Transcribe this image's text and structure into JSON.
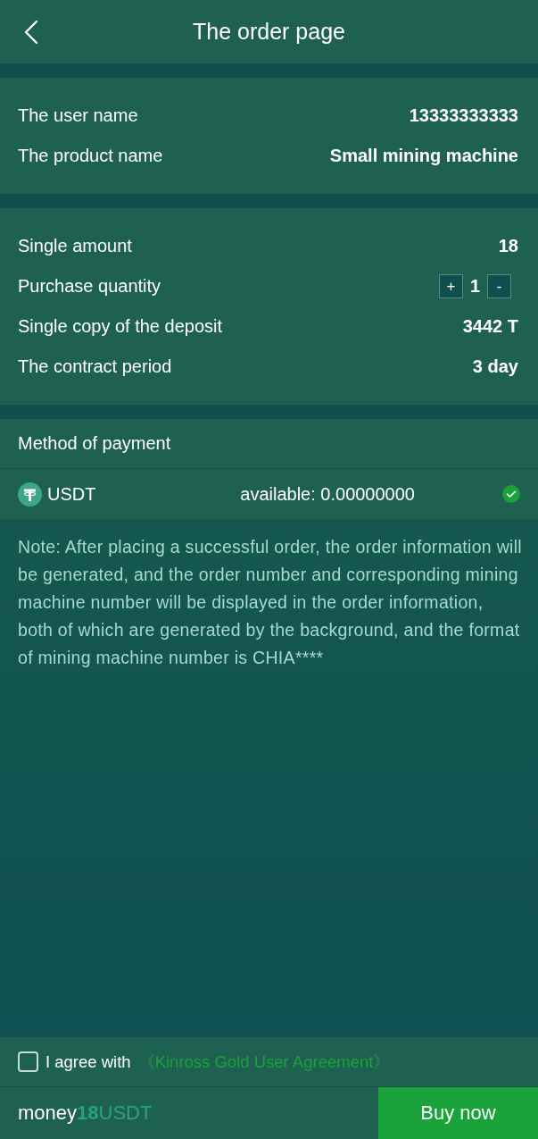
{
  "header": {
    "title": "The order page"
  },
  "sections": [
    {
      "rows": [
        {
          "kind": "text",
          "label": "The user name",
          "value": "13333333333"
        },
        {
          "kind": "text",
          "label": "The product name",
          "value": "Small mining machine"
        }
      ]
    },
    {
      "rows": [
        {
          "kind": "text",
          "label": "Single amount",
          "value": "18"
        },
        {
          "kind": "stepper",
          "label": "Purchase quantity",
          "increment": "+",
          "value": "1",
          "decrement": "-"
        },
        {
          "kind": "text",
          "label": "Single copy of the deposit",
          "value": "3442 T"
        },
        {
          "kind": "text",
          "label": "The contract period",
          "value": "3 day"
        }
      ]
    }
  ],
  "payment": {
    "title": "Method of payment",
    "methods": [
      {
        "name": "USDT",
        "available": "available: 0.00000000",
        "selected": true
      }
    ]
  },
  "note": "Note: After placing a successful order, the order information will be generated, and the order number and corresponding mining machine number will be displayed in the order information, both of which are generated by the background, and the format of mining machine number is CHIA****",
  "agreement": {
    "checked": false,
    "text": "I agree with",
    "link": "《Kinross Gold User Agreement》"
  },
  "footer": {
    "label": "money",
    "amount": "18",
    "unit": "USDT",
    "button": "Buy now"
  }
}
